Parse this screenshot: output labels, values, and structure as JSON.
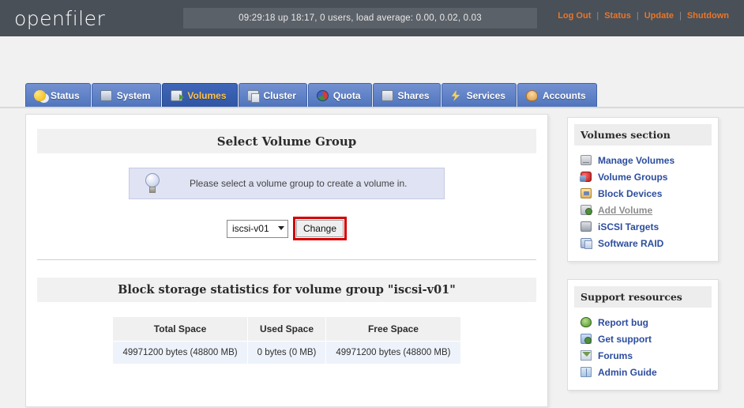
{
  "header": {
    "logo": "openfiler",
    "uptime": "09:29:18 up 18:17, 0 users, load average: 0.00, 0.02, 0.03",
    "links": [
      {
        "label": "Log Out",
        "name": "log-out-link"
      },
      {
        "label": "Status",
        "name": "status-link"
      },
      {
        "label": "Update",
        "name": "update-link"
      },
      {
        "label": "Shutdown",
        "name": "shutdown-link"
      }
    ],
    "separator": "|",
    "accent_color": "#e8762a",
    "bar_color": "#4a5058"
  },
  "tabs": [
    {
      "label": "Status",
      "icon": "sun-cloud-icon",
      "active": false
    },
    {
      "label": "System",
      "icon": "monitor-icon",
      "active": false
    },
    {
      "label": "Volumes",
      "icon": "volume-disk-icon",
      "active": true
    },
    {
      "label": "Cluster",
      "icon": "servers-icon",
      "active": false
    },
    {
      "label": "Quota",
      "icon": "pie-chart-icon",
      "active": false
    },
    {
      "label": "Shares",
      "icon": "share-drive-icon",
      "active": false
    },
    {
      "label": "Services",
      "icon": "lightning-icon",
      "active": false
    },
    {
      "label": "Accounts",
      "icon": "user-icon",
      "active": false
    }
  ],
  "tab_colors": {
    "active_text": "#ffc34d",
    "tab_blue": "#4f74bd"
  },
  "main": {
    "section1_title": "Select Volume Group",
    "tip": {
      "icon": "lightbulb-icon",
      "text": "Please select a volume group to create a volume in."
    },
    "volume_group_select": {
      "value": "iscsi-v01",
      "options": [
        "iscsi-v01"
      ]
    },
    "change_button": "Change",
    "highlight_color": "#d40000",
    "section2_title": "Block storage statistics for volume group \"iscsi-v01\"",
    "stats_table": {
      "headers": [
        "Total Space",
        "Used Space",
        "Free Space"
      ],
      "rows": [
        [
          "49971200 bytes (48800 MB)",
          "0 bytes (0 MB)",
          "49971200 bytes (48800 MB)"
        ]
      ]
    }
  },
  "sidebar": {
    "panels": [
      {
        "title": "Volumes section",
        "name": "volumes-section-panel",
        "links": [
          {
            "label": "Manage Volumes",
            "icon": "drive-icon",
            "current": false
          },
          {
            "label": "Volume Groups",
            "icon": "volume-group-icon",
            "current": false
          },
          {
            "label": "Block Devices",
            "icon": "block-device-icon",
            "current": false
          },
          {
            "label": "Add Volume",
            "icon": "add-volume-icon",
            "current": true
          },
          {
            "label": "iSCSI Targets",
            "icon": "iscsi-target-icon",
            "current": false
          },
          {
            "label": "Software RAID",
            "icon": "raid-icon",
            "current": false
          }
        ]
      },
      {
        "title": "Support resources",
        "name": "support-resources-panel",
        "links": [
          {
            "label": "Report bug",
            "icon": "bug-icon",
            "current": false
          },
          {
            "label": "Get support",
            "icon": "support-icon",
            "current": false
          },
          {
            "label": "Forums",
            "icon": "forum-icon",
            "current": false
          },
          {
            "label": "Admin Guide",
            "icon": "admin-guide-icon",
            "current": false
          }
        ]
      }
    ],
    "link_color": "#2c4d9e"
  }
}
